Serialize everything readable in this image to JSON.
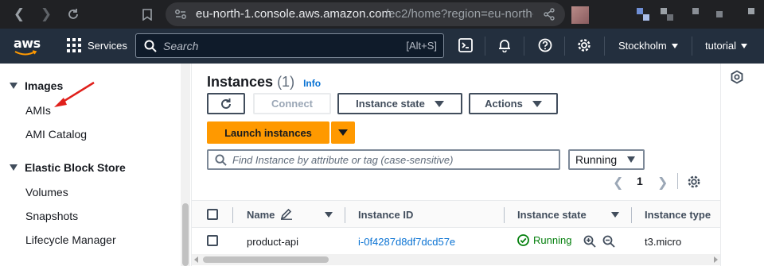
{
  "browser": {
    "url_host": "eu-north-1.console.aws.amazon.com",
    "url_path": "/ec2/home?region=eu-north-..."
  },
  "aws_nav": {
    "logo_text": "aws",
    "services_label": "Services",
    "search_placeholder": "Search",
    "search_shortcut": "[Alt+S]",
    "region_label": "Stockholm",
    "account_label": "tutorial"
  },
  "sidebar": {
    "sections": [
      {
        "title": "Images",
        "items": [
          "AMIs",
          "AMI Catalog"
        ]
      },
      {
        "title": "Elastic Block Store",
        "items": [
          "Volumes",
          "Snapshots",
          "Lifecycle Manager"
        ]
      }
    ]
  },
  "instances": {
    "title": "Instances",
    "count": "(1)",
    "info_link": "Info",
    "connect_label": "Connect",
    "instance_state_label": "Instance state",
    "actions_label": "Actions",
    "launch_label": "Launch instances",
    "filter_placeholder": "Find Instance by attribute or tag (case-sensitive)",
    "state_filter": "Running",
    "page": "1",
    "columns": [
      "Name",
      "Instance ID",
      "Instance state",
      "Instance type"
    ],
    "rows": [
      {
        "name": "product-api",
        "instance_id": "i-0f4287d8df7dcd57e",
        "state": "Running",
        "type": "t3.micro"
      }
    ]
  },
  "colors": {
    "aws_nav_bg": "#232f3e",
    "primary_orange": "#ff9900",
    "link_blue": "#0972d3",
    "success_green": "#037f0c",
    "annotation_red": "#e0201b"
  }
}
